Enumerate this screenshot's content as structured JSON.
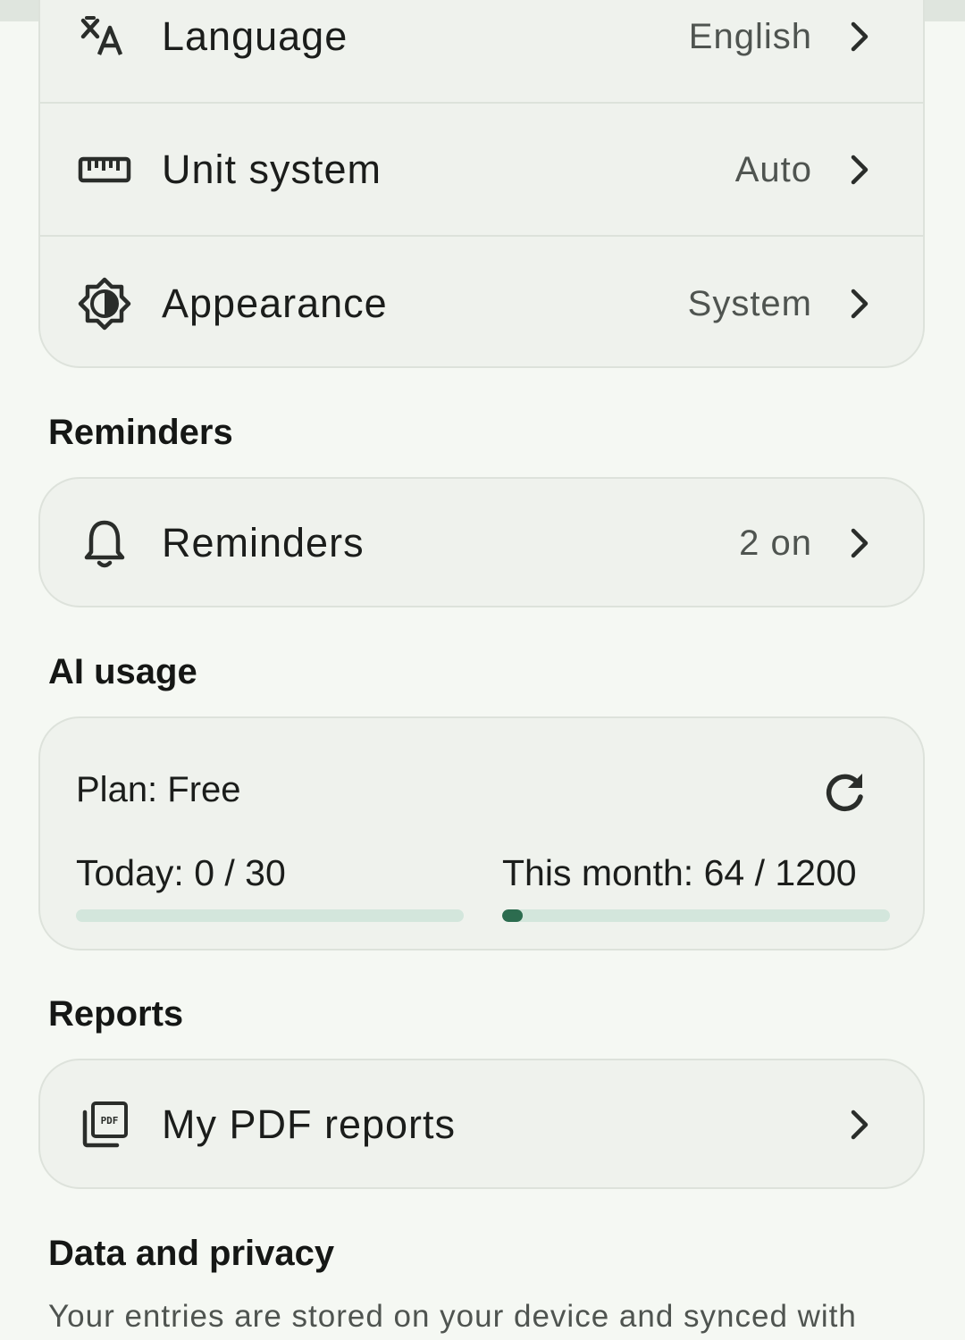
{
  "general": {
    "rows": [
      {
        "label": "Language",
        "value": "English",
        "icon": "translate-icon"
      },
      {
        "label": "Unit system",
        "value": "Auto",
        "icon": "ruler-icon"
      },
      {
        "label": "Appearance",
        "value": "System",
        "icon": "brightness-icon"
      }
    ]
  },
  "reminders": {
    "section_title": "Reminders",
    "row": {
      "label": "Reminders",
      "value": "2 on",
      "icon": "bell-icon"
    }
  },
  "ai_usage": {
    "section_title": "AI usage",
    "plan": "Plan: Free",
    "today": "Today: 0 / 30",
    "today_fraction": 0.0,
    "month": "This month: 64 / 1200",
    "month_fraction": 0.053,
    "refresh_icon": "refresh-icon"
  },
  "reports": {
    "section_title": "Reports",
    "row": {
      "label": "My PDF reports",
      "icon": "pdf-icon"
    }
  },
  "privacy": {
    "section_title": "Data and privacy",
    "text": "Your entries are stored on your device and synced with"
  },
  "colors": {
    "background": "#f5f8f3",
    "card": "#eff2ed",
    "accent": "#2c6c4f",
    "bar_track": "#d3e6dc"
  }
}
